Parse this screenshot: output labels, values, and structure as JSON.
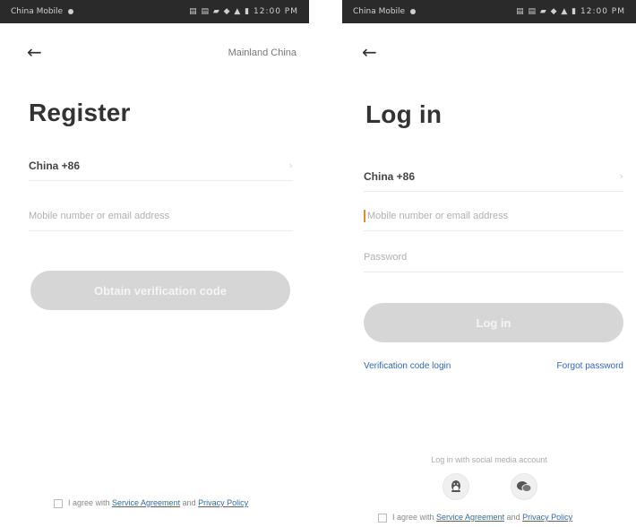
{
  "register": {
    "status_carrier": "China Mobile",
    "status_right": "▤ ▤ ▰ ◆ ▲ ▮ 12:00 PM",
    "back_icon": "←",
    "region_link": "Mainland China",
    "title": "Register",
    "country_value": "China +86",
    "phone_placeholder": "Mobile number or email address",
    "get_code_button": "Obtain verification code",
    "agree_prefix": "I agree with ",
    "service_agreement": "Service Agreement",
    "and": " and ",
    "privacy_policy": "Privacy Policy"
  },
  "login": {
    "status_carrier": "China Mobile",
    "status_right": "▤ ▤ ▰ ◆ ▲ ▮ 12:00 PM",
    "back_icon": "←",
    "title": "Log in",
    "country_value": "China +86",
    "phone_placeholder": "Mobile number or email address",
    "password_placeholder": "Password",
    "login_button": "Log in",
    "verification_link": "Verification code login",
    "forgot_link": "Forgot password",
    "social_caption": "Log in with social media account",
    "agree_prefix": "I agree with ",
    "service_agreement": "Service Agreement",
    "and": " and ",
    "privacy_policy": "Privacy Policy"
  },
  "icons": {
    "chevron": "›",
    "qq": "qq-icon",
    "wechat": "wechat-icon"
  },
  "colors": {
    "status_bar": "#2a2a2a",
    "button_disabled": "#d6d6d6",
    "link_blue": "#2f69b8",
    "cursor_orange": "#e58b2a"
  }
}
